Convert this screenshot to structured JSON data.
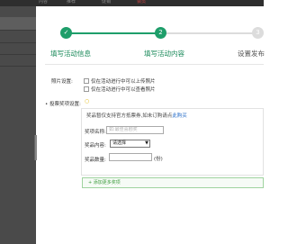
{
  "topnav": {
    "items": [
      "内容",
      "推荐",
      "促销",
      "会员"
    ]
  },
  "stepper": {
    "steps": [
      {
        "number": "1",
        "label": "填写活动信息",
        "done": true
      },
      {
        "number": "2",
        "label": "填写活动内容",
        "done": true
      },
      {
        "number": "3",
        "label": "设置发布",
        "done": false
      }
    ]
  },
  "photo": {
    "label": "照片设置:",
    "options": [
      "仅在活动进行中可以上传照片",
      "仅在活动进行中可以查看照片"
    ]
  },
  "prize": {
    "section_label": "投票奖项设置:",
    "tip": "奖品暂仅支持官方抵票券,如未订购请点",
    "tip_link": "此购买",
    "name_label": "奖项名称:",
    "name_placeholder": "如:最佳喜剧奖",
    "content_label": "奖品内容:",
    "content_select": "请选择",
    "count_label": "奖品数量:",
    "count_value": "",
    "count_unit": "(份)",
    "add_label": "+ 添加更多奖项"
  },
  "colors": {
    "accent": "#1e9e6a",
    "link": "#2a6fc9",
    "sidebar": "#4a4a4a"
  }
}
